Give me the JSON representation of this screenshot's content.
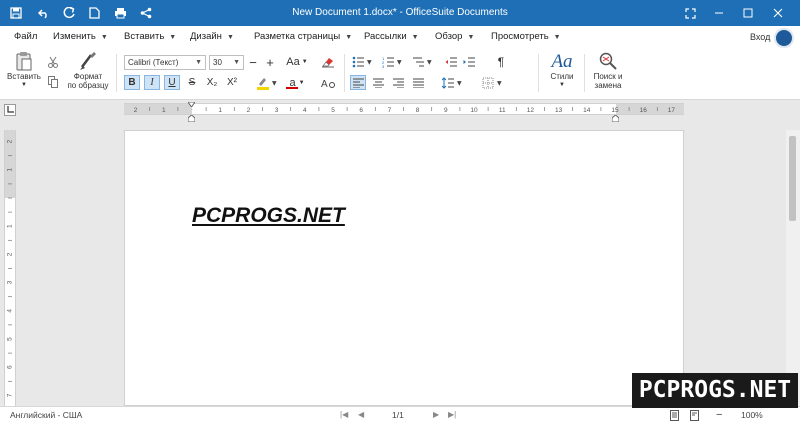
{
  "titlebar": {
    "title": "New Document 1.docx* - OfficeSuite Documents",
    "icons": [
      "save-icon",
      "undo-icon",
      "redo-icon",
      "new-document-icon",
      "print-icon",
      "share-icon"
    ],
    "window_controls": [
      "fullscreen-icon",
      "minimize-icon",
      "maximize-icon",
      "close-icon"
    ],
    "background": "#1e6fb5"
  },
  "menu": {
    "items": [
      "Файл",
      "Изменить",
      "Вставить",
      "Дизайн",
      "Разметка страницы",
      "Рассылки",
      "Обзор",
      "Просмотреть"
    ],
    "login": "Вход"
  },
  "ribbon": {
    "paste_label": "Вставить",
    "format_painter_line1": "Формат",
    "format_painter_line2": "по образцу",
    "font_name": "Calibri (Текст)",
    "font_size": "30",
    "decrease_font": "−",
    "increase_font": "+",
    "change_case": "Aa",
    "bold": "B",
    "italic": "I",
    "underline": "U",
    "strikethrough": "S",
    "subscript": "X₂",
    "superscript": "X²",
    "font_color_letter": "a",
    "pilcrow": "¶",
    "styles_label": "Стили",
    "styles_glyph": "Aa",
    "find_line1": "Поиск и",
    "find_line2": "замена",
    "accent_highlight": "#f2d600",
    "accent_font_color": "#d40000"
  },
  "ruler": {
    "top_numbers": [
      "2",
      "1",
      "1",
      "2",
      "3",
      "4",
      "5",
      "6",
      "7",
      "8",
      "9",
      "10",
      "11",
      "12",
      "13",
      "14",
      "15",
      "16",
      "17",
      "18"
    ],
    "left_numbers": [
      "2",
      "1",
      "1",
      "2",
      "3",
      "4",
      "5",
      "6",
      "7",
      "8",
      "9",
      "10"
    ]
  },
  "document": {
    "text": "PCPROGS.NET"
  },
  "status": {
    "language": "Английский - США",
    "page": "1/1",
    "zoom": "100%"
  },
  "watermark": {
    "text": "PCPROGS.NET"
  }
}
